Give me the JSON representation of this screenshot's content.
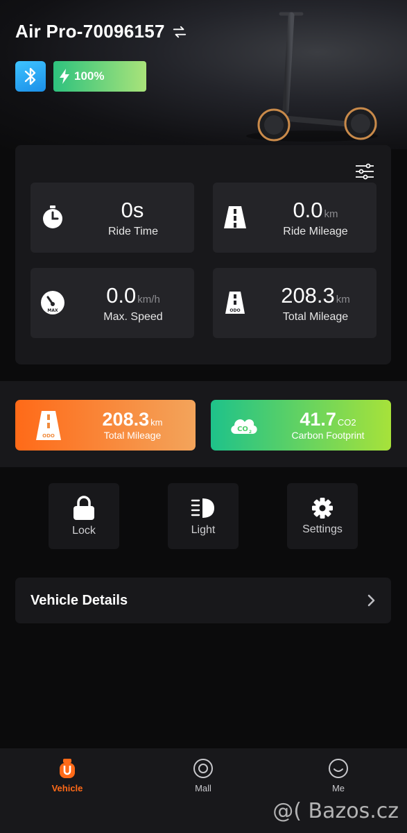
{
  "header": {
    "title": "Air Pro-70096157",
    "battery": "100%"
  },
  "stats": [
    {
      "value": "0s",
      "unit": "",
      "label": "Ride Time",
      "icon": "stopwatch-icon"
    },
    {
      "value": "0.0",
      "unit": "km",
      "label": "Ride Mileage",
      "icon": "road-icon"
    },
    {
      "value": "0.0",
      "unit": "km/h",
      "label": "Max. Speed",
      "icon": "speedometer-icon"
    },
    {
      "value": "208.3",
      "unit": "km",
      "label": "Total Mileage",
      "icon": "odometer-road-icon"
    }
  ],
  "highlights": {
    "mileage": {
      "value": "208.3",
      "unit": "km",
      "label": "Total Mileage"
    },
    "carbon": {
      "value": "41.7",
      "unit": "CO2",
      "label": "Carbon Footprint"
    }
  },
  "controls": {
    "lock": "Lock",
    "light": "Light",
    "settings": "Settings"
  },
  "details": {
    "label": "Vehicle Details"
  },
  "tabs": {
    "vehicle": "Vehicle",
    "mall": "Mall",
    "me": "Me"
  },
  "watermark": "@( Bazos.cz",
  "colors": {
    "accent": "#ff6a18",
    "panel": "#18181b",
    "card": "#242428",
    "green": "#2ec27e",
    "blue": "#1b8fe8"
  }
}
